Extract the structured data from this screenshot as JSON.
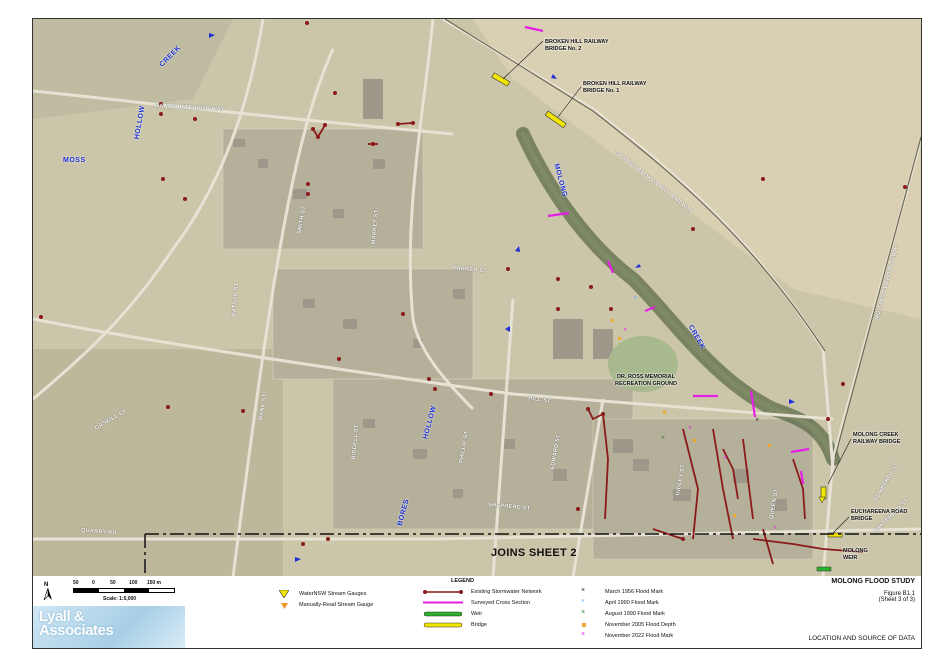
{
  "map": {
    "street_labels": {
      "banjo_paterson_way": "BANJO PATERSON WAY",
      "orange_broken_hill_railway": "ORANGE BROKEN HILL RAILWAY",
      "molong_dubbo_railway": "MOLONG DUBBO RAILWAY",
      "smith_st": "SMITH ST",
      "watson_st": "WATSON ST",
      "bank_st": "BANK ST",
      "hill_st": "HILL ST",
      "riddell_st": "RIDDELL ST",
      "phillip_st": "PHILLIP ST",
      "edward_st": "EDWARD ST",
      "gidley_st": "GIDLEY ST",
      "queen_st": "QUEEN ST",
      "quarry_rd": "QUARRY RD",
      "gaskill_st": "GASKILL ST",
      "market_st": "MARKET ST",
      "parker_st": "PARKER ST",
      "shepherd_st": "SHEPHERD ST",
      "bumberry_st": "BUMBERRY ST",
      "whitehead_st": "WHITEHEAD ST"
    },
    "creek_labels": {
      "creek_1": "CREEK",
      "hollow_1": "HOLLOW",
      "moss": "MOSS",
      "molong": "MOLONG",
      "creek_2": "CREEK",
      "hollow_2": "HOLLOW",
      "bores": "BORES"
    },
    "callouts": {
      "bridge_2": "BROKEN HILL RAILWAY\nBRIDGE No. 2",
      "bridge_1": "BROKEN HILL RAILWAY\nBRIDGE No. 1",
      "recreation_ground": "DR. ROSS MEMORIAL\nRECREATION GROUND",
      "molong_creek_bridge": "MOLONG CREEK\nRAILWAY BRIDGE",
      "eucahareena_bridge": "EUCHAREENA ROAD\nBRIDGE",
      "molong_weir": "MOLONG\nWEIR"
    },
    "joins_label": "JOINS SHEET 2"
  },
  "scale": {
    "ticks": [
      "50",
      "0",
      "50",
      "100",
      "150 m"
    ],
    "text": "Scale: 1:5,000",
    "north": "N"
  },
  "logo": {
    "line1": "Lyall &",
    "line2": "Associates"
  },
  "legend": {
    "title": "LEGEND",
    "col1": [
      {
        "label": "WaterNSW Stream Gauges",
        "icon": "yellow-triangle",
        "color": "#f2e600"
      },
      {
        "label": "Manually-Read Stream Gauge",
        "icon": "orange-triangle",
        "color": "#f0962a"
      }
    ],
    "col2": [
      {
        "label": "Existing Stormwater Network",
        "icon": "maroon-line",
        "color": "#8b1a1a"
      },
      {
        "label": "Surveyed Cross Section",
        "icon": "magenta-line",
        "color": "#e61ee6"
      },
      {
        "label": "Weir",
        "icon": "green-bar",
        "color": "#2bb02b"
      },
      {
        "label": "Bridge",
        "icon": "yellow-bar",
        "color": "#f2e600"
      }
    ],
    "col3": [
      {
        "label": "March 1956 Flood Mark",
        "icon": "x-mark",
        "color": "#222222"
      },
      {
        "label": "April 1990 Flood Mark",
        "icon": "x-mark",
        "color": "#7ab0ff"
      },
      {
        "label": "August 1990 Flood Mark",
        "icon": "x-mark",
        "color": "#2c7a2c"
      },
      {
        "label": "November 2005 Flood Depth",
        "icon": "square-mark",
        "color": "#f0a830"
      },
      {
        "label": "November 2022 Flood Mark",
        "icon": "x-mark",
        "color": "#e61ee6"
      }
    ]
  },
  "title_block": {
    "study": "MOLONG FLOOD STUDY",
    "figure": "Figure B1.1",
    "sheet": "(Sheet 3 of 3)",
    "subtitle": "LOCATION AND SOURCE OF DATA"
  }
}
